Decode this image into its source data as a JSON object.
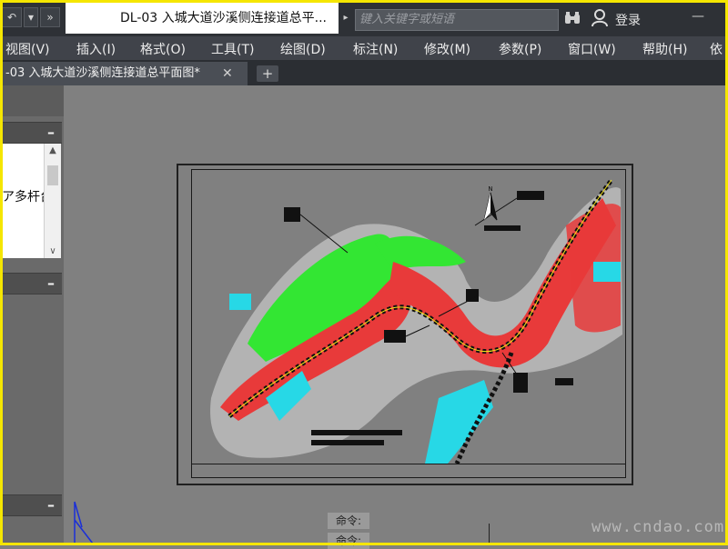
{
  "window": {
    "title": "DL-03 入城大道沙溪侧连接道总平...",
    "search_placeholder": "键入关键字或短语",
    "login_label": "登录",
    "qa_undo": "↶",
    "qa_dropdown": "▾",
    "qa_more": "»",
    "title_arrow": "▸",
    "binoculars": "🔭",
    "minimize": "—"
  },
  "menu": {
    "items": [
      "视图(V)",
      "插入(I)",
      "格式(O)",
      "工具(T)",
      "绘图(D)",
      "标注(N)",
      "修改(M)",
      "参数(P)",
      "窗口(W)",
      "帮助(H)",
      "依"
    ]
  },
  "tabs": {
    "active_label": "-03 入城大道沙溪侧连接道总平面图*",
    "close_glyph": "✕",
    "add_glyph": "+"
  },
  "palette": {
    "collapse_glyph": "–",
    "list_text": "ア多杆台",
    "scroll_up": "▲",
    "scroll_down": "∨"
  },
  "command": {
    "line1": "命令:",
    "line2": "命令:"
  },
  "watermark": "www.cndao.com",
  "colors": {
    "titlebar": "#2e3136",
    "menubar": "#40434a",
    "canvas": "#808080",
    "road_red": "#e83a3a",
    "green_area": "#33e633",
    "cyan_area": "#27d8e6",
    "frame_border": "#f5e600"
  }
}
